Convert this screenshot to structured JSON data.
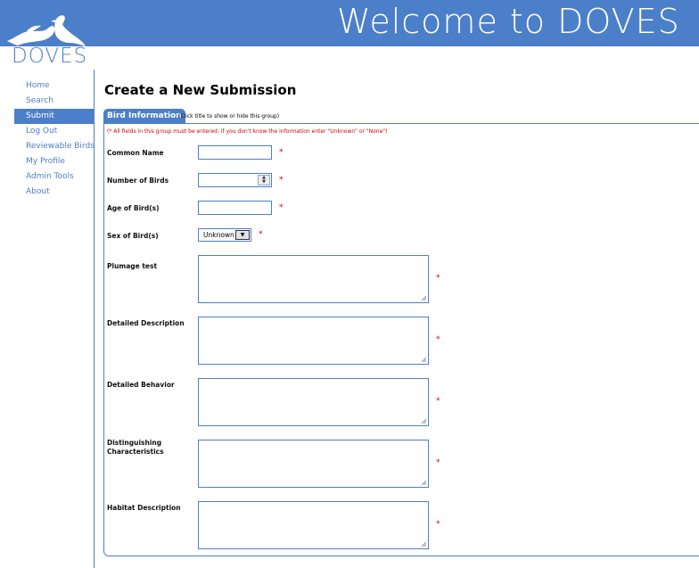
{
  "header": {
    "title": "Welcome to DOVES",
    "logo_text": "DOVES",
    "logo_icon": "doves-icon",
    "brand_color": "#4c7fc9"
  },
  "sidebar": {
    "items": [
      {
        "label": "Home"
      },
      {
        "label": "Search"
      },
      {
        "label": "Submit",
        "active": true
      },
      {
        "label": "Log Out"
      },
      {
        "label": "Reviewable Birds"
      },
      {
        "label": "My Profile"
      },
      {
        "label": "Admin Tools"
      },
      {
        "label": "About"
      }
    ]
  },
  "main": {
    "page_title": "Create a New Submission",
    "group": {
      "tab_label": "Bird Information",
      "tab_hint": "(Click title to show or hide this group)",
      "note": "(* All fields in this group must be entered, if you don't know the information enter \"Unknown\" or \"None\")",
      "required_mark": "*",
      "fields": {
        "common_name": {
          "label": "Common Name",
          "value": ""
        },
        "number_of_birds": {
          "label": "Number of Birds",
          "value": ""
        },
        "age_of_birds": {
          "label": "Age of Bird(s)",
          "value": ""
        },
        "sex_of_birds": {
          "label": "Sex of Bird(s)",
          "selected": "Unknown"
        },
        "plumage_test": {
          "label": "Plumage test",
          "value": ""
        },
        "detailed_description": {
          "label": "Detailed Description",
          "value": ""
        },
        "detailed_behavior": {
          "label": "Detailed Behavior",
          "value": ""
        },
        "distinguishing_characteristics": {
          "label": "Distinguishing\nCharacteristics",
          "value": ""
        },
        "habitat_description": {
          "label": "Habitat Description",
          "value": ""
        }
      }
    }
  }
}
